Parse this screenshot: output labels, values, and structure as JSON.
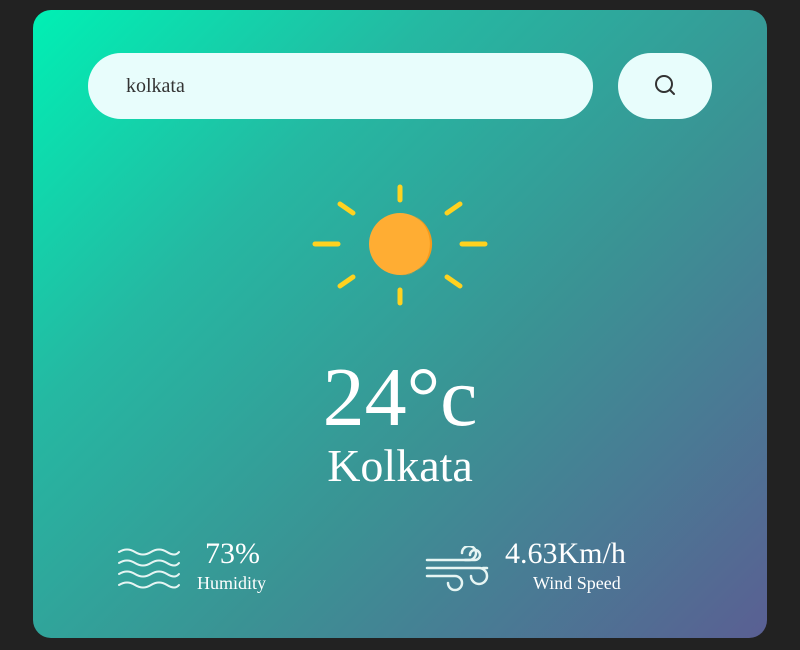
{
  "search": {
    "value": "kolkata",
    "button_icon": "search-icon"
  },
  "weather": {
    "icon": "sun-icon",
    "temperature": "24°c",
    "city": "Kolkata"
  },
  "details": {
    "humidity": {
      "value": "73%",
      "label": "Humidity",
      "icon": "humidity-waves-icon"
    },
    "wind": {
      "value": "4.63Km/h",
      "label": "Wind Speed",
      "icon": "wind-icon"
    }
  },
  "colors": {
    "background": "#222222",
    "card_gradient_start": "#00f0b4",
    "card_gradient_end": "#5a5f93",
    "input_bg": "#e8fdfc",
    "sun_body": "#ffad33",
    "sun_rays": "#ffd21f",
    "text": "#ffffff"
  }
}
